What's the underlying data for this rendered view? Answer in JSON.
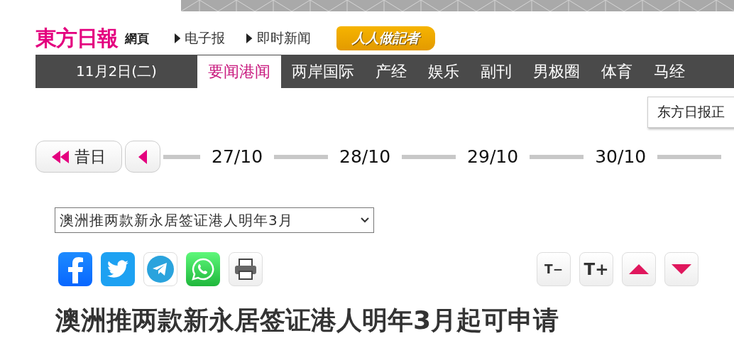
{
  "header": {
    "logo": "東方日報",
    "logo_sub": "網頁",
    "links": [
      "电子报",
      "即时新闻"
    ],
    "badge": "人人做記者"
  },
  "nav": {
    "date": "11月2日(二)",
    "tabs": [
      {
        "label": "要闻港闻",
        "selected": true
      },
      {
        "label": "两岸国际",
        "selected": false
      },
      {
        "label": "产经",
        "selected": false
      },
      {
        "label": "娱乐",
        "selected": false
      },
      {
        "label": "副刊",
        "selected": false
      },
      {
        "label": "男极圈",
        "selected": false
      },
      {
        "label": "体育",
        "selected": false
      },
      {
        "label": "马经",
        "selected": false
      }
    ]
  },
  "tooltip": "东方日报正",
  "date_nav": {
    "back_label": "昔日",
    "dates": [
      "27/10",
      "28/10",
      "29/10",
      "30/10"
    ]
  },
  "article_select": {
    "value": "澳洲推两款新永居签证港人明年3月"
  },
  "font_buttons": [
    "T−",
    "T+"
  ],
  "title": "澳洲推两款新永居签证港人明年3月起可申请"
}
